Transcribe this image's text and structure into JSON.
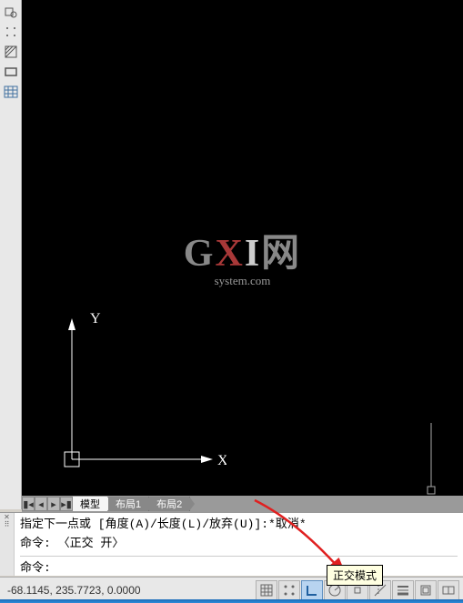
{
  "left_tools": [
    {
      "name": "layer-state-icon"
    },
    {
      "name": "point-style-icon"
    },
    {
      "name": "hatch-icon"
    },
    {
      "name": "rectangle-icon"
    },
    {
      "name": "table-icon"
    }
  ],
  "ucs": {
    "x_label": "X",
    "y_label": "Y"
  },
  "watermark": {
    "text_g": "G",
    "text_x": "X",
    "text_i": "I",
    "text_wang": "网",
    "subtitle": "system.com"
  },
  "tabs": {
    "items": [
      {
        "label": "模型",
        "active": true
      },
      {
        "label": "布局1",
        "active": false
      },
      {
        "label": "布局2",
        "active": false
      }
    ]
  },
  "command": {
    "line1": "指定下一点或 [角度(A)/长度(L)/放弃(U)]:*取消*",
    "line2": "命令: 〈正交 开〉",
    "prompt": "命令:"
  },
  "status": {
    "coords": "-68.1145, 235.7723, 0.0000",
    "tooltip": "正交模式",
    "buttons": [
      {
        "name": "grid-icon",
        "active": false
      },
      {
        "name": "snap-icon",
        "active": false
      },
      {
        "name": "ortho-icon",
        "active": true
      },
      {
        "name": "polar-icon",
        "active": false
      },
      {
        "name": "osnap-icon",
        "active": false
      },
      {
        "name": "otrack-icon",
        "active": false
      },
      {
        "name": "lineweight-icon",
        "active": false
      },
      {
        "name": "model-icon",
        "active": false
      },
      {
        "name": "annotation-icon",
        "active": false
      }
    ]
  }
}
